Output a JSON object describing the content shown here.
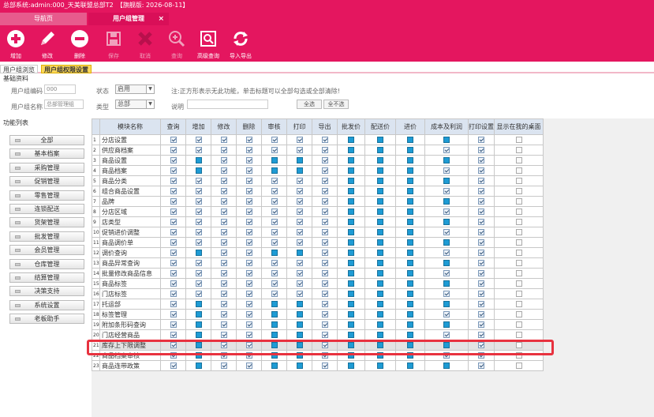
{
  "title": "总部系统:admin:000_天美联盟总部T2　【旗舰版: 2026-08-11】",
  "tabs": [
    {
      "label": "导航页"
    },
    {
      "label": "用户组管理",
      "close": "×"
    }
  ],
  "toolbar": [
    {
      "label": "增加",
      "icon": "plus-circle-icon",
      "enabled": true
    },
    {
      "label": "修改",
      "icon": "pencil-icon",
      "enabled": true
    },
    {
      "label": "删除",
      "icon": "minus-circle-icon",
      "enabled": true
    },
    {
      "label": "保存",
      "icon": "save-icon",
      "enabled": false
    },
    {
      "label": "取消",
      "icon": "cancel-icon",
      "enabled": false
    },
    {
      "label": "查询",
      "icon": "search-icon",
      "enabled": false
    },
    {
      "label": "高级查询",
      "icon": "advanced-search-icon",
      "enabled": true
    },
    {
      "label": "导入导出",
      "icon": "refresh-icon",
      "enabled": true
    }
  ],
  "subtabs": {
    "a": "用户组浏览",
    "b": "用户组权限设置"
  },
  "basic": {
    "section_title": "基础资料",
    "code_label": "用户组编码",
    "code_value": "000",
    "name_label": "用户组名称",
    "name_value": "总部管理组",
    "status_label": "状态",
    "status_value": "启用",
    "type_label": "类型",
    "type_value": "总部",
    "desc_label": "说明",
    "note": "注:正方形表示无此功能，单击标题可以全部勾选或全部清除!",
    "select_all": "全选",
    "select_none": "全不选"
  },
  "func_title": "功能列表",
  "menu": [
    "全部",
    "基本档案",
    "采购管理",
    "促销管理",
    "零售管理",
    "连锁配送",
    "货架管理",
    "批发管理",
    "会员管理",
    "仓库管理",
    "结算管理",
    "决策支持",
    "系统设置",
    "老板助手"
  ],
  "columns": [
    "模块名称",
    "查询",
    "增加",
    "修改",
    "删除",
    "审核",
    "打印",
    "导出",
    "批发价",
    "配送价",
    "进价",
    "成本及利润",
    "打印设置",
    "显示在我的桌面"
  ],
  "rows": [
    {
      "n": "1",
      "name": "分店设置"
    },
    {
      "n": "2",
      "name": "供应商档案"
    },
    {
      "n": "3",
      "name": "商品设置"
    },
    {
      "n": "4",
      "name": "商品档案"
    },
    {
      "n": "5",
      "name": "商品分类"
    },
    {
      "n": "6",
      "name": "组合商品设置"
    },
    {
      "n": "7",
      "name": "品牌"
    },
    {
      "n": "8",
      "name": "分店区域"
    },
    {
      "n": "9",
      "name": "店类型"
    },
    {
      "n": "10",
      "name": "促销进价调整"
    },
    {
      "n": "11",
      "name": "商品调价单"
    },
    {
      "n": "12",
      "name": "调价查询"
    },
    {
      "n": "13",
      "name": "商品异常查询"
    },
    {
      "n": "14",
      "name": "批量修改商品信息"
    },
    {
      "n": "15",
      "name": "商品标签"
    },
    {
      "n": "16",
      "name": "门店标签"
    },
    {
      "n": "17",
      "name": "托运部"
    },
    {
      "n": "18",
      "name": "标签管理"
    },
    {
      "n": "19",
      "name": "附加条形码查询"
    },
    {
      "n": "20",
      "name": "门店经营商品"
    },
    {
      "n": "21",
      "name": "库存上下限调整",
      "selected": true
    },
    {
      "n": "22",
      "name": "商品档案审核"
    },
    {
      "n": "23",
      "name": "商品连带政策"
    }
  ],
  "colors": {
    "brand": "#e4165f",
    "highlight": "#e8323f",
    "fill": "#1e9bd4"
  }
}
